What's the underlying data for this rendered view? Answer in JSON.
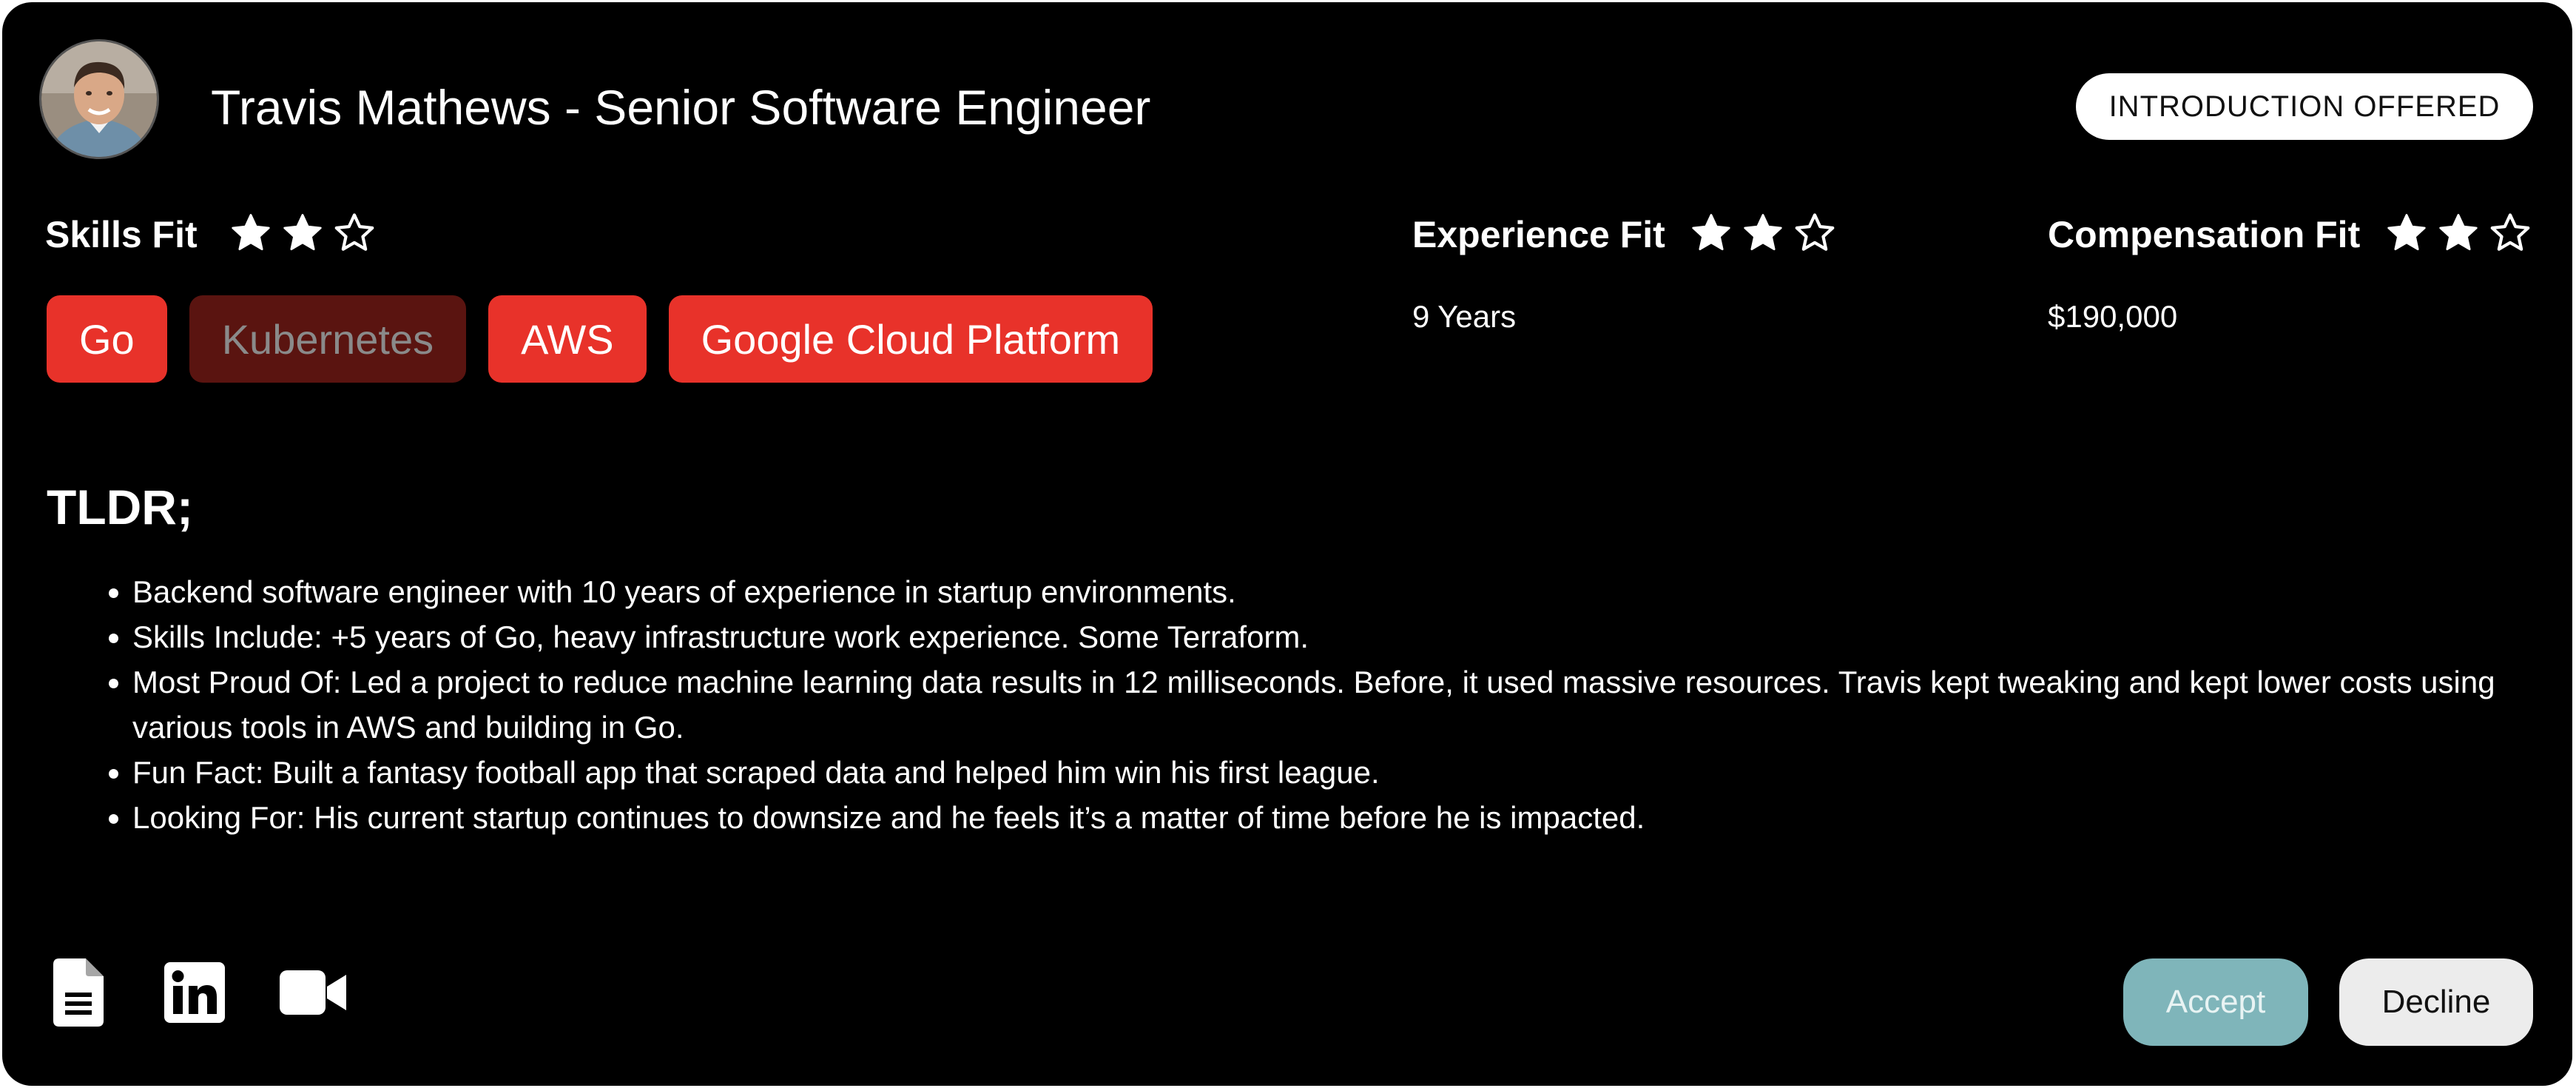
{
  "candidate": {
    "title": "Travis Mathews - Senior Software Engineer",
    "status": "INTRODUCTION OFFERED"
  },
  "skills_fit": {
    "label": "Skills Fit",
    "rating": 2,
    "max_rating": 3,
    "tags": [
      {
        "label": "Go",
        "active": true
      },
      {
        "label": "Kubernetes",
        "active": false
      },
      {
        "label": "AWS",
        "active": true
      },
      {
        "label": "Google Cloud Platform",
        "active": true
      }
    ]
  },
  "experience_fit": {
    "label": "Experience Fit",
    "rating": 2,
    "max_rating": 3,
    "value": "9 Years"
  },
  "compensation_fit": {
    "label": "Compensation Fit",
    "rating": 2,
    "max_rating": 3,
    "value": "$190,000"
  },
  "tldr": {
    "heading": "TLDR;",
    "items": [
      "Backend software engineer with 10 years of experience in startup environments.",
      "Skills Include: +5 years of Go, heavy infrastructure work experience. Some Terraform.",
      "Most Proud Of: Led a project to reduce machine learning data results in 12 milliseconds. Before, it used massive resources. Travis kept tweaking and kept lower costs using various tools in AWS and building in Go.",
      "Fun Fact: Built a fantasy football app that scraped data and helped him win his first league.",
      "Looking For: His current startup continues to downsize and he feels it’s a matter of time before he is impacted."
    ]
  },
  "footer": {
    "icons": [
      "resume-document-icon",
      "linkedin-icon",
      "video-camera-icon"
    ],
    "accept_label": "Accept",
    "decline_label": "Decline"
  },
  "colors": {
    "background": "#000000",
    "tag_active": "#e8322a",
    "tag_inactive": "#5a1410",
    "accept": "#7fb5ba",
    "decline": "#ececec"
  }
}
